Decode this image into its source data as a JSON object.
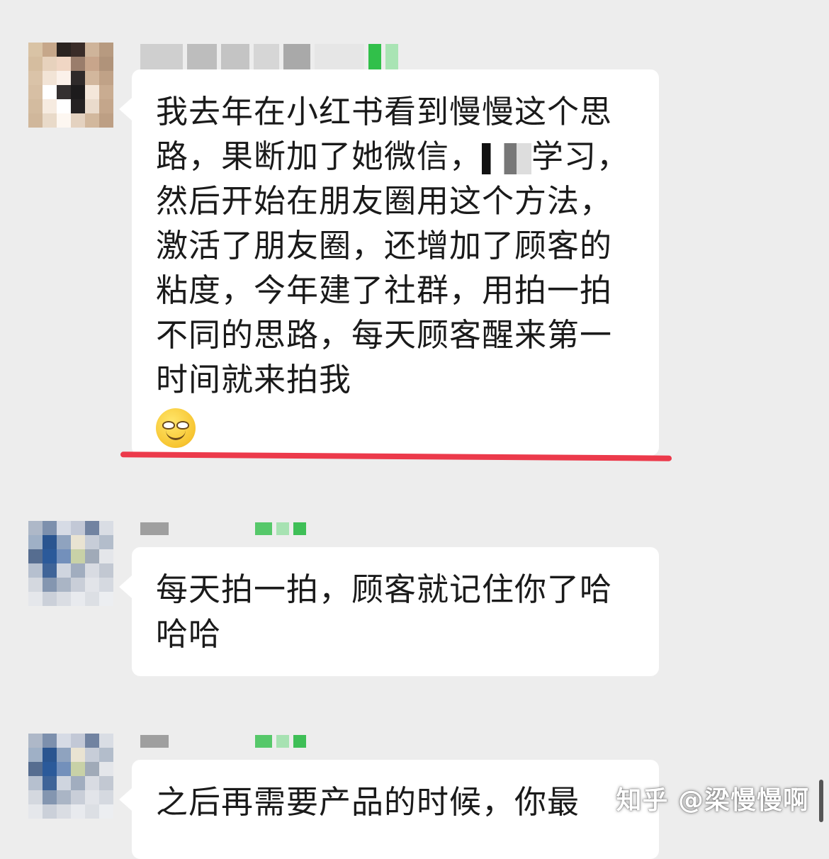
{
  "messages": [
    {
      "text_part1": "我去年在小红书看到慢慢这个思路，果断加了她微信，",
      "text_part2": "学习，然后开始在朋友圈用这个方法，激活了朋友圈，还增加了顾客的粘度，今年建了社群，用拍一拍不同的思路，每天顾客醒来第一时间就来拍我",
      "emoji": "smiling-face-emoji"
    },
    {
      "text": "每天拍一拍，顾客就记住你了哈哈哈"
    },
    {
      "text": "之后再需要产品的时候，你最"
    }
  ],
  "watermark": "知乎 @梁慢慢啊",
  "colors": {
    "background": "#ededed",
    "bubble": "#ffffff",
    "highlight_underline": "#ec3a4b"
  }
}
